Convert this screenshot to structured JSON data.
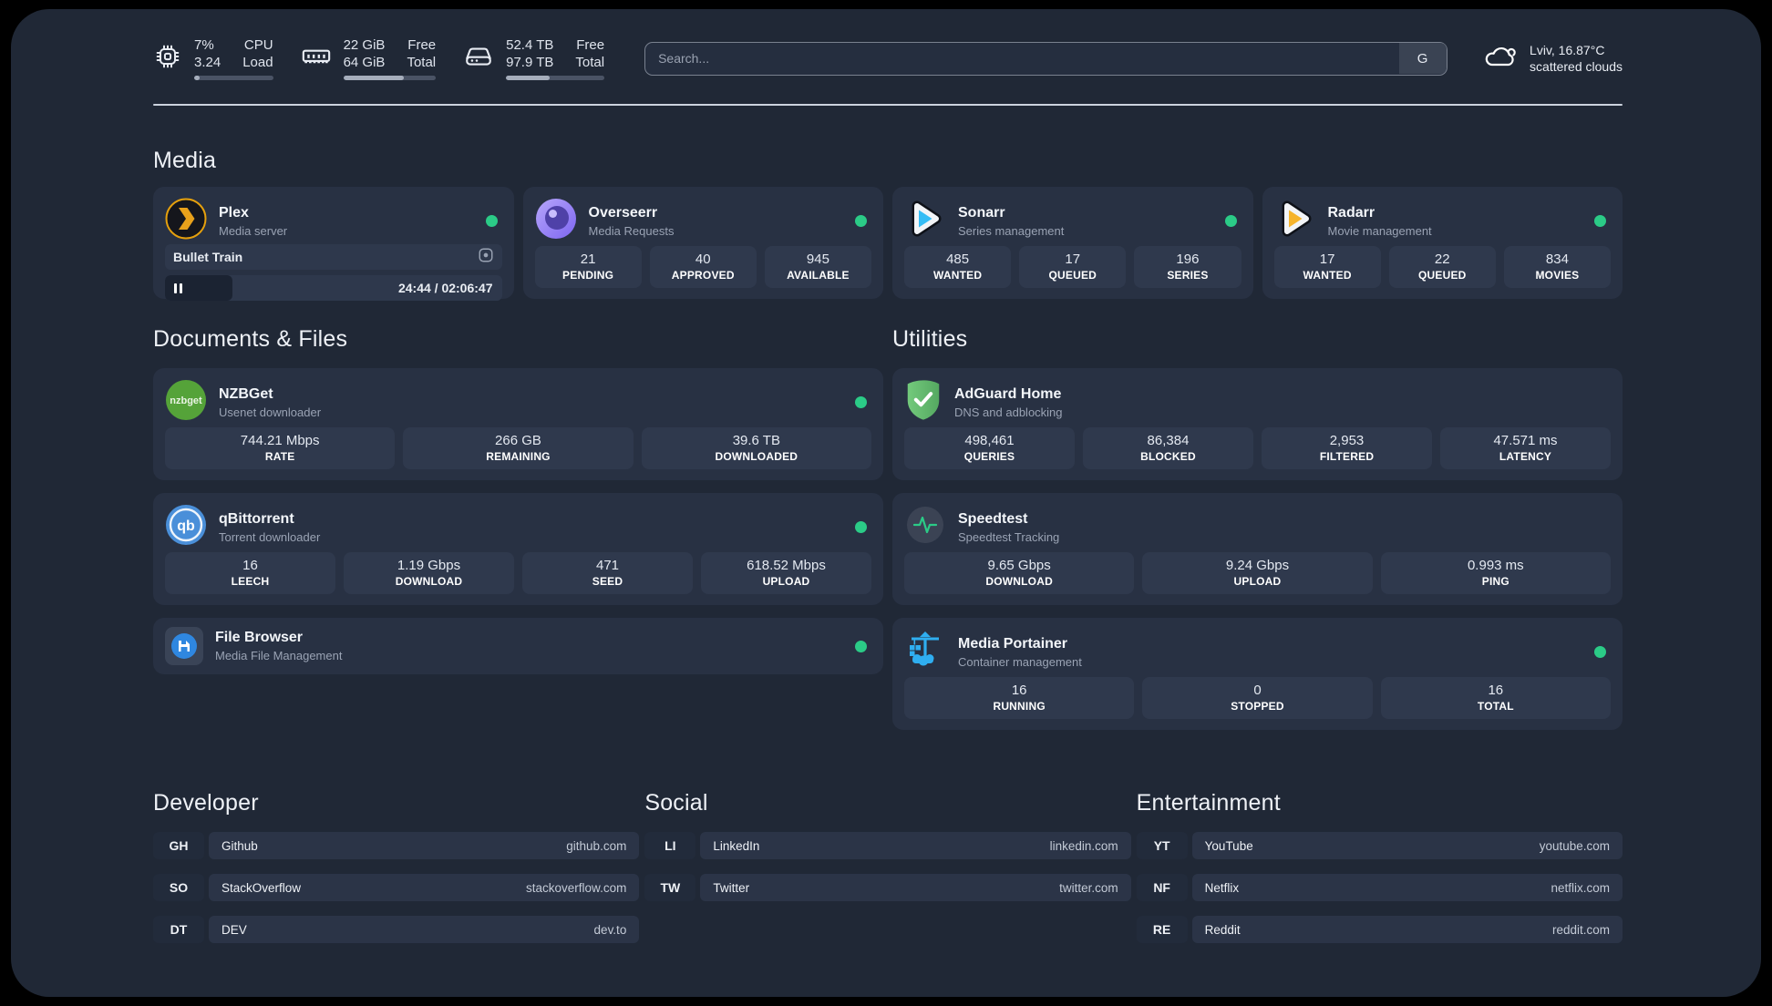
{
  "header": {
    "metrics": [
      {
        "name": "cpu",
        "value_line1": "7%",
        "value_line2": "3.24",
        "label_line1": "CPU",
        "label_line2": "Load",
        "progress_pct": 7
      },
      {
        "name": "memory",
        "value_line1": "22 GiB",
        "value_line2": "64 GiB",
        "label_line1": "Free",
        "label_line2": "Total",
        "progress_pct": 65
      },
      {
        "name": "storage",
        "value_line1": "52.4 TB",
        "value_line2": "97.9 TB",
        "label_line1": "Free",
        "label_line2": "Total",
        "progress_pct": 44
      }
    ],
    "search": {
      "placeholder": "Search...",
      "engine_button": "G"
    },
    "weather": {
      "line1": "Lviv, 16.87°C",
      "line2": "scattered clouds"
    }
  },
  "sections": {
    "media": {
      "title": "Media",
      "cards": [
        {
          "name": "plex",
          "title": "Plex",
          "subtitle": "Media server",
          "online": true,
          "player": {
            "track": "Bullet Train",
            "time": "24:44 / 02:06:47",
            "progress_pct": 20
          }
        },
        {
          "name": "overseerr",
          "title": "Overseerr",
          "subtitle": "Media Requests",
          "online": true,
          "stats": [
            {
              "value": "21",
              "label": "PENDING"
            },
            {
              "value": "40",
              "label": "APPROVED"
            },
            {
              "value": "945",
              "label": "AVAILABLE"
            }
          ]
        },
        {
          "name": "sonarr",
          "title": "Sonarr",
          "subtitle": "Series management",
          "online": true,
          "stats": [
            {
              "value": "485",
              "label": "WANTED"
            },
            {
              "value": "17",
              "label": "QUEUED"
            },
            {
              "value": "196",
              "label": "SERIES"
            }
          ]
        },
        {
          "name": "radarr",
          "title": "Radarr",
          "subtitle": "Movie management",
          "online": true,
          "stats": [
            {
              "value": "17",
              "label": "WANTED"
            },
            {
              "value": "22",
              "label": "QUEUED"
            },
            {
              "value": "834",
              "label": "MOVIES"
            }
          ]
        }
      ]
    },
    "documents": {
      "title": "Documents & Files",
      "cards": [
        {
          "name": "nzbget",
          "title": "NZBGet",
          "subtitle": "Usenet downloader",
          "online": true,
          "stats": [
            {
              "value": "744.21 Mbps",
              "label": "RATE"
            },
            {
              "value": "266 GB",
              "label": "REMAINING"
            },
            {
              "value": "39.6 TB",
              "label": "DOWNLOADED"
            }
          ]
        },
        {
          "name": "qbittorrent",
          "title": "qBittorrent",
          "subtitle": "Torrent downloader",
          "online": true,
          "stats": [
            {
              "value": "16",
              "label": "LEECH"
            },
            {
              "value": "1.19 Gbps",
              "label": "DOWNLOAD"
            },
            {
              "value": "471",
              "label": "SEED"
            },
            {
              "value": "618.52 Mbps",
              "label": "UPLOAD"
            }
          ]
        },
        {
          "name": "filebrowser",
          "title": "File Browser",
          "subtitle": "Media File Management",
          "online": true
        }
      ]
    },
    "utilities": {
      "title": "Utilities",
      "cards": [
        {
          "name": "adguard",
          "title": "AdGuard Home",
          "subtitle": "DNS and adblocking",
          "online": false,
          "stats": [
            {
              "value": "498,461",
              "label": "QUERIES"
            },
            {
              "value": "86,384",
              "label": "BLOCKED"
            },
            {
              "value": "2,953",
              "label": "FILTERED"
            },
            {
              "value": "47.571 ms",
              "label": "LATENCY"
            }
          ]
        },
        {
          "name": "speedtest",
          "title": "Speedtest",
          "subtitle": "Speedtest Tracking",
          "online": false,
          "stats": [
            {
              "value": "9.65 Gbps",
              "label": "DOWNLOAD"
            },
            {
              "value": "9.24 Gbps",
              "label": "UPLOAD"
            },
            {
              "value": "0.993 ms",
              "label": "PING"
            }
          ]
        },
        {
          "name": "portainer",
          "title": "Media Portainer",
          "subtitle": "Container management",
          "online": true,
          "stats": [
            {
              "value": "16",
              "label": "RUNNING"
            },
            {
              "value": "0",
              "label": "STOPPED"
            },
            {
              "value": "16",
              "label": "TOTAL"
            }
          ]
        }
      ]
    },
    "developer": {
      "title": "Developer",
      "links": [
        {
          "abbr": "GH",
          "name": "Github",
          "url": "github.com"
        },
        {
          "abbr": "SO",
          "name": "StackOverflow",
          "url": "stackoverflow.com"
        },
        {
          "abbr": "DT",
          "name": "DEV",
          "url": "dev.to"
        }
      ]
    },
    "social": {
      "title": "Social",
      "links": [
        {
          "abbr": "LI",
          "name": "LinkedIn",
          "url": "linkedin.com"
        },
        {
          "abbr": "TW",
          "name": "Twitter",
          "url": "twitter.com"
        }
      ]
    },
    "entertainment": {
      "title": "Entertainment",
      "links": [
        {
          "abbr": "YT",
          "name": "YouTube",
          "url": "youtube.com"
        },
        {
          "abbr": "NF",
          "name": "Netflix",
          "url": "netflix.com"
        },
        {
          "abbr": "RE",
          "name": "Reddit",
          "url": "reddit.com"
        }
      ]
    }
  },
  "colors": {
    "page_bg": "#202836",
    "card_bg": "#283143",
    "stat_tile_bg": "#2f394d",
    "status_online": "#2bcb87",
    "plex_gold": "#e5a00d",
    "sonarr_blue": "#38bdf8",
    "radarr_amber": "#f6b42c",
    "nzbget_green": "#55a339",
    "qbittorrent_blue": "#4a8fd9",
    "adguard_green": "#66c36e",
    "portainer_blue": "#2faef0",
    "speedtest_pulse": "#2bcb87"
  }
}
